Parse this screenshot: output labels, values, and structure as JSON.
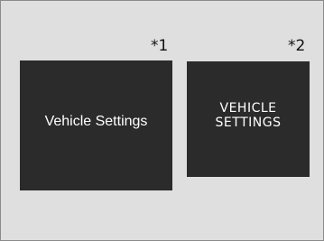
{
  "footnote_marks": {
    "screen_1": "*1",
    "screen_2": "*2"
  },
  "screens": {
    "screen_1": {
      "label": "Vehicle Settings"
    },
    "screen_2": {
      "label_lines": [
        "VEHICLE",
        "SETTINGS"
      ]
    }
  },
  "colors": {
    "background": "#dfdfdf",
    "screen": "#2b2b2b",
    "screen_text": "#ffffff",
    "border": "#8a8a8a"
  }
}
